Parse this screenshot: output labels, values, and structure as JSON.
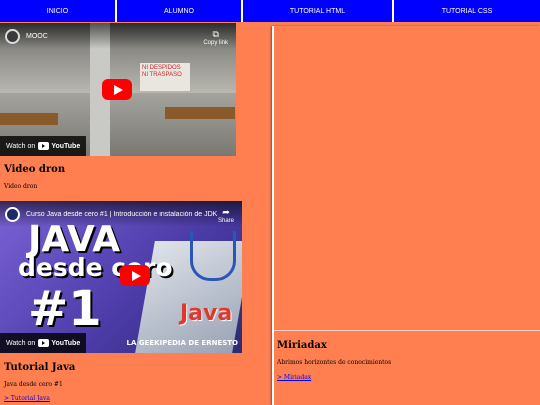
{
  "nav": {
    "items": [
      {
        "label": "INICIO"
      },
      {
        "label": "ALUMNO"
      },
      {
        "label": "TUTORIAL HTML"
      },
      {
        "label": "TUTORIAL CSS"
      }
    ]
  },
  "left": {
    "video1": {
      "title": "MOOC",
      "copy_link": "Copy link",
      "watch_on": "Watch on",
      "youtube": "YouTube",
      "banner": "NI DESPIDOS NI TRASPASO"
    },
    "card1": {
      "title": "Video dron",
      "text": "Video dron"
    },
    "video2": {
      "title": "Curso Java desde cero #1 | Introducción e instalación de JDK",
      "share": "Share",
      "watch_on": "Watch on",
      "youtube": "YouTube",
      "thumb_line1": "JAVA",
      "thumb_line2": "desde cero",
      "thumb_line3": "#1",
      "thumb_logo": "Java",
      "brand": "LA GEEKIPEDIA DE ERNESTO"
    },
    "card2": {
      "title": "Tutorial Java",
      "text": "Java desde cero #1",
      "link": "> Tutorial Java"
    }
  },
  "right": {
    "card": {
      "title": "Miriadax",
      "text": "Abrimos horizontes de conocimientos",
      "link": "> Miriadax"
    }
  },
  "colors": {
    "background": "#ff7f50",
    "nav": "#0000ff",
    "link": "#0000ee",
    "play": "#ff0000"
  }
}
